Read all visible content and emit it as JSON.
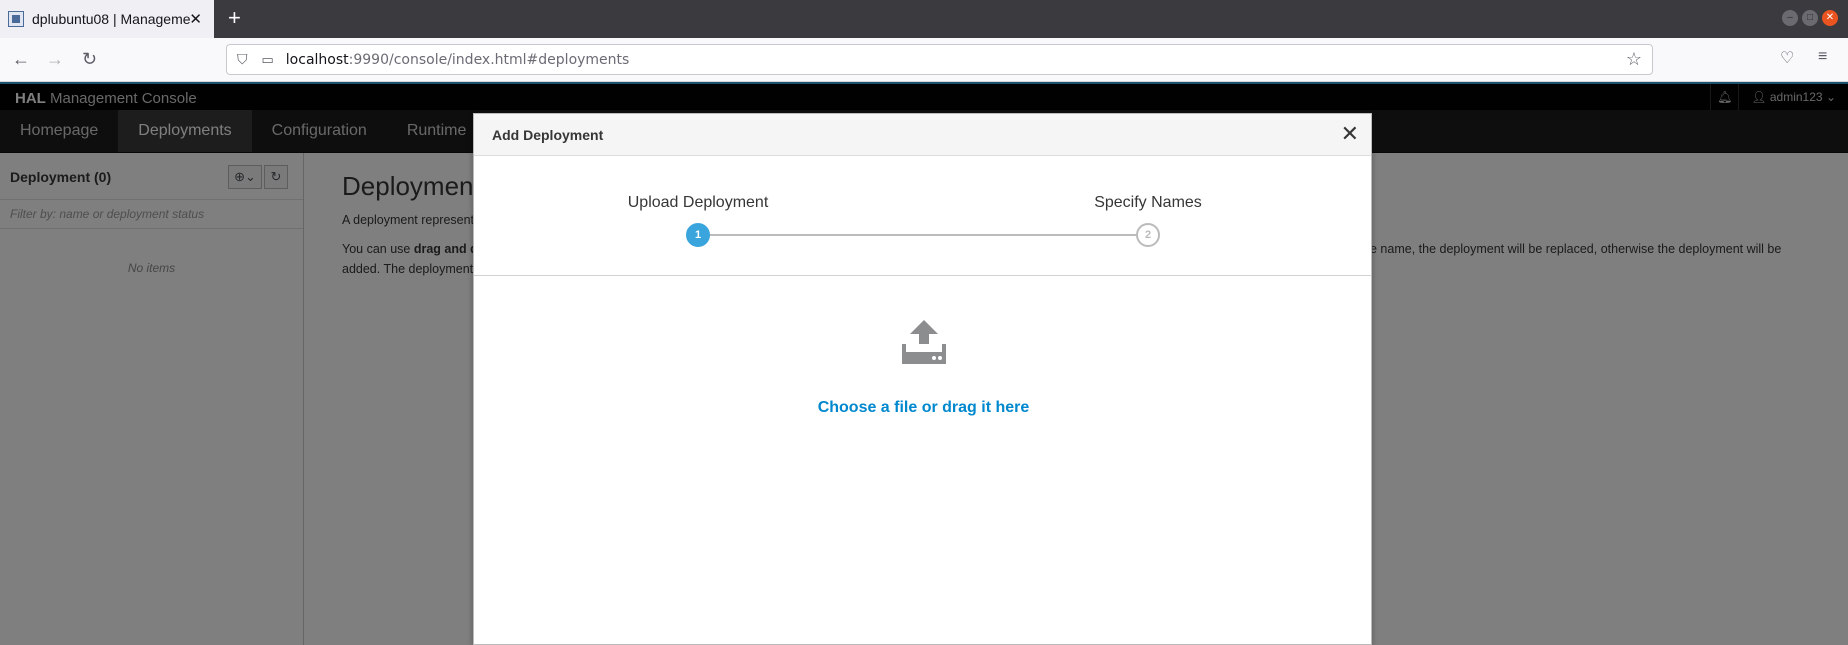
{
  "browser": {
    "tab_title": "dplubuntu08 | Manageme",
    "url_host": "localhost",
    "url_rest": ":9990/console/index.html#deployments"
  },
  "hal": {
    "brand_bold": "HAL",
    "brand_rest": "Management Console",
    "user": "admin123",
    "nav": [
      "Homepage",
      "Deployments",
      "Configuration",
      "Runtime"
    ]
  },
  "sidebar": {
    "title": "Deployment (0)",
    "filter_placeholder": "Filter by: name or deployment status",
    "empty": "No items"
  },
  "main": {
    "heading": "Deployments",
    "p1": "A deployment represents a",
    "p2_a": "You can use ",
    "p2_bold": "drag and drop",
    "p2_right": "e name, the deployment will be replaced, otherwise the deployment will be",
    "p3": "added. The deployments a"
  },
  "modal": {
    "title": "Add Deployment",
    "steps": [
      {
        "label": "Upload Deployment",
        "number": "1"
      },
      {
        "label": "Specify Names",
        "number": "2"
      }
    ],
    "upload_text": "Choose a file or drag it here"
  },
  "colors": {
    "accent": "#39a5dc",
    "link": "#0088ce"
  }
}
